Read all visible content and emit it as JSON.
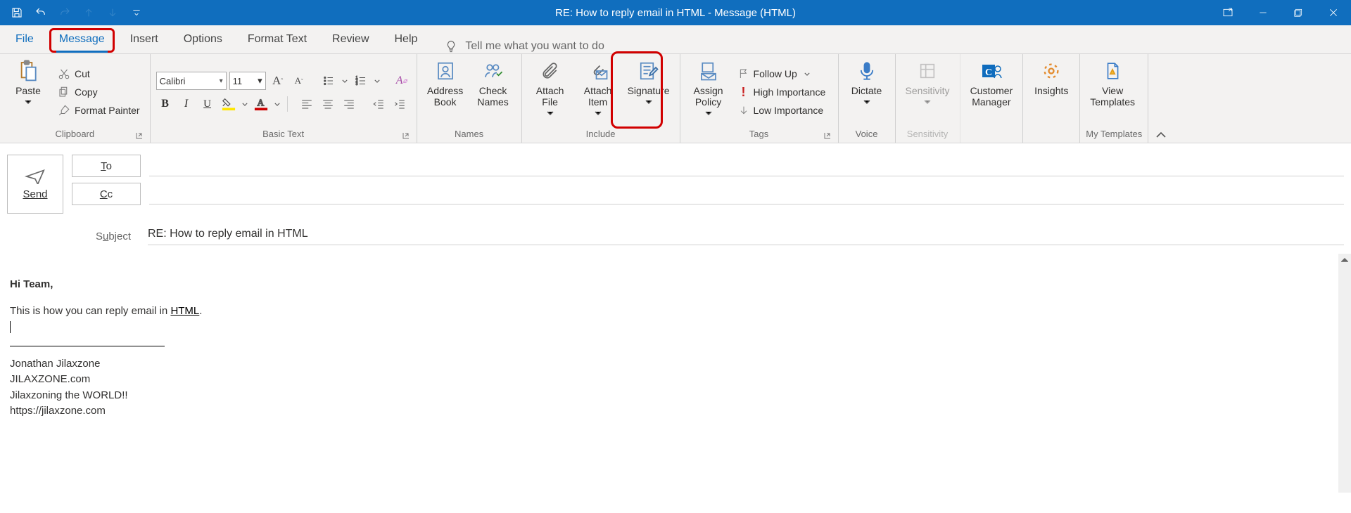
{
  "window": {
    "title": "RE: How to reply email in HTML  -  Message (HTML)"
  },
  "tabs": {
    "file": "File",
    "message": "Message",
    "insert": "Insert",
    "options": "Options",
    "format_text": "Format Text",
    "review": "Review",
    "help": "Help",
    "tellme": "Tell me what you want to do"
  },
  "ribbon": {
    "clipboard": {
      "group": "Clipboard",
      "paste": "Paste",
      "cut": "Cut",
      "copy": "Copy",
      "format_painter": "Format Painter"
    },
    "basic_text": {
      "group": "Basic Text",
      "font_name": "Calibri",
      "font_size": "11"
    },
    "names": {
      "group": "Names",
      "address_book": "Address\nBook",
      "check_names": "Check\nNames"
    },
    "include": {
      "group": "Include",
      "attach_file": "Attach\nFile",
      "attach_item": "Attach\nItem",
      "signature": "Signature"
    },
    "tags": {
      "group": "Tags",
      "assign_policy": "Assign\nPolicy",
      "follow_up": "Follow Up",
      "high_importance": "High Importance",
      "low_importance": "Low Importance"
    },
    "voice": {
      "group": "Voice",
      "dictate": "Dictate"
    },
    "sensitivity": {
      "group": "Sensitivity",
      "sensitivity": "Sensitivity"
    },
    "customer_manager": "Customer\nManager",
    "insights": "Insights",
    "view_templates": "View\nTemplates",
    "my_templates": "My Templates"
  },
  "compose": {
    "send": "Send",
    "to": "To",
    "cc": "Cc",
    "subject_label": "Subject",
    "subject_value": "RE: How to reply email in HTML"
  },
  "body": {
    "greeting": "Hi Team,",
    "line1_pre": "This is how you can reply email in ",
    "line1_link": "HTML",
    "line1_post": ".",
    "sig_name": "Jonathan Jilaxzone",
    "sig_site": "JILAXZONE.com",
    "sig_tag": "Jilaxzoning the WORLD!!",
    "sig_url": "https://jilaxzone.com"
  }
}
